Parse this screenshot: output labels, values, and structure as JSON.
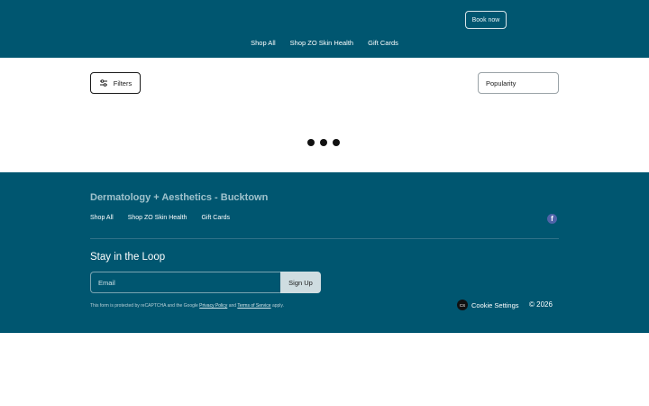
{
  "header": {
    "book_label": "Book now",
    "nav": [
      "Shop All",
      "Shop ZO Skin Health",
      "Gift Cards"
    ]
  },
  "toolbar": {
    "filters_label": "Filters",
    "sort_value": "Popularity"
  },
  "footer": {
    "brand": "Dermatology + Aesthetics - Bucktown",
    "links": [
      "Shop All",
      "Shop ZO Skin Health",
      "Gift Cards"
    ],
    "social_icon": "facebook-icon",
    "newsletter_title": "Stay in the Loop",
    "email_placeholder": "Email",
    "signup_label": "Sign Up",
    "recaptcha_prefix": "This form is protected by reCAPTCHA and the Google",
    "privacy_label": "Privacy Policy",
    "and_text": "and",
    "terms_label": "Terms of Service",
    "apply_text": "apply.",
    "cookie_icon_text": "CS",
    "cookie_label": "Cookie Settings",
    "copyright": "© 2026"
  },
  "colors": {
    "brand_teal": "#005670",
    "loader_dot": "#111111"
  }
}
